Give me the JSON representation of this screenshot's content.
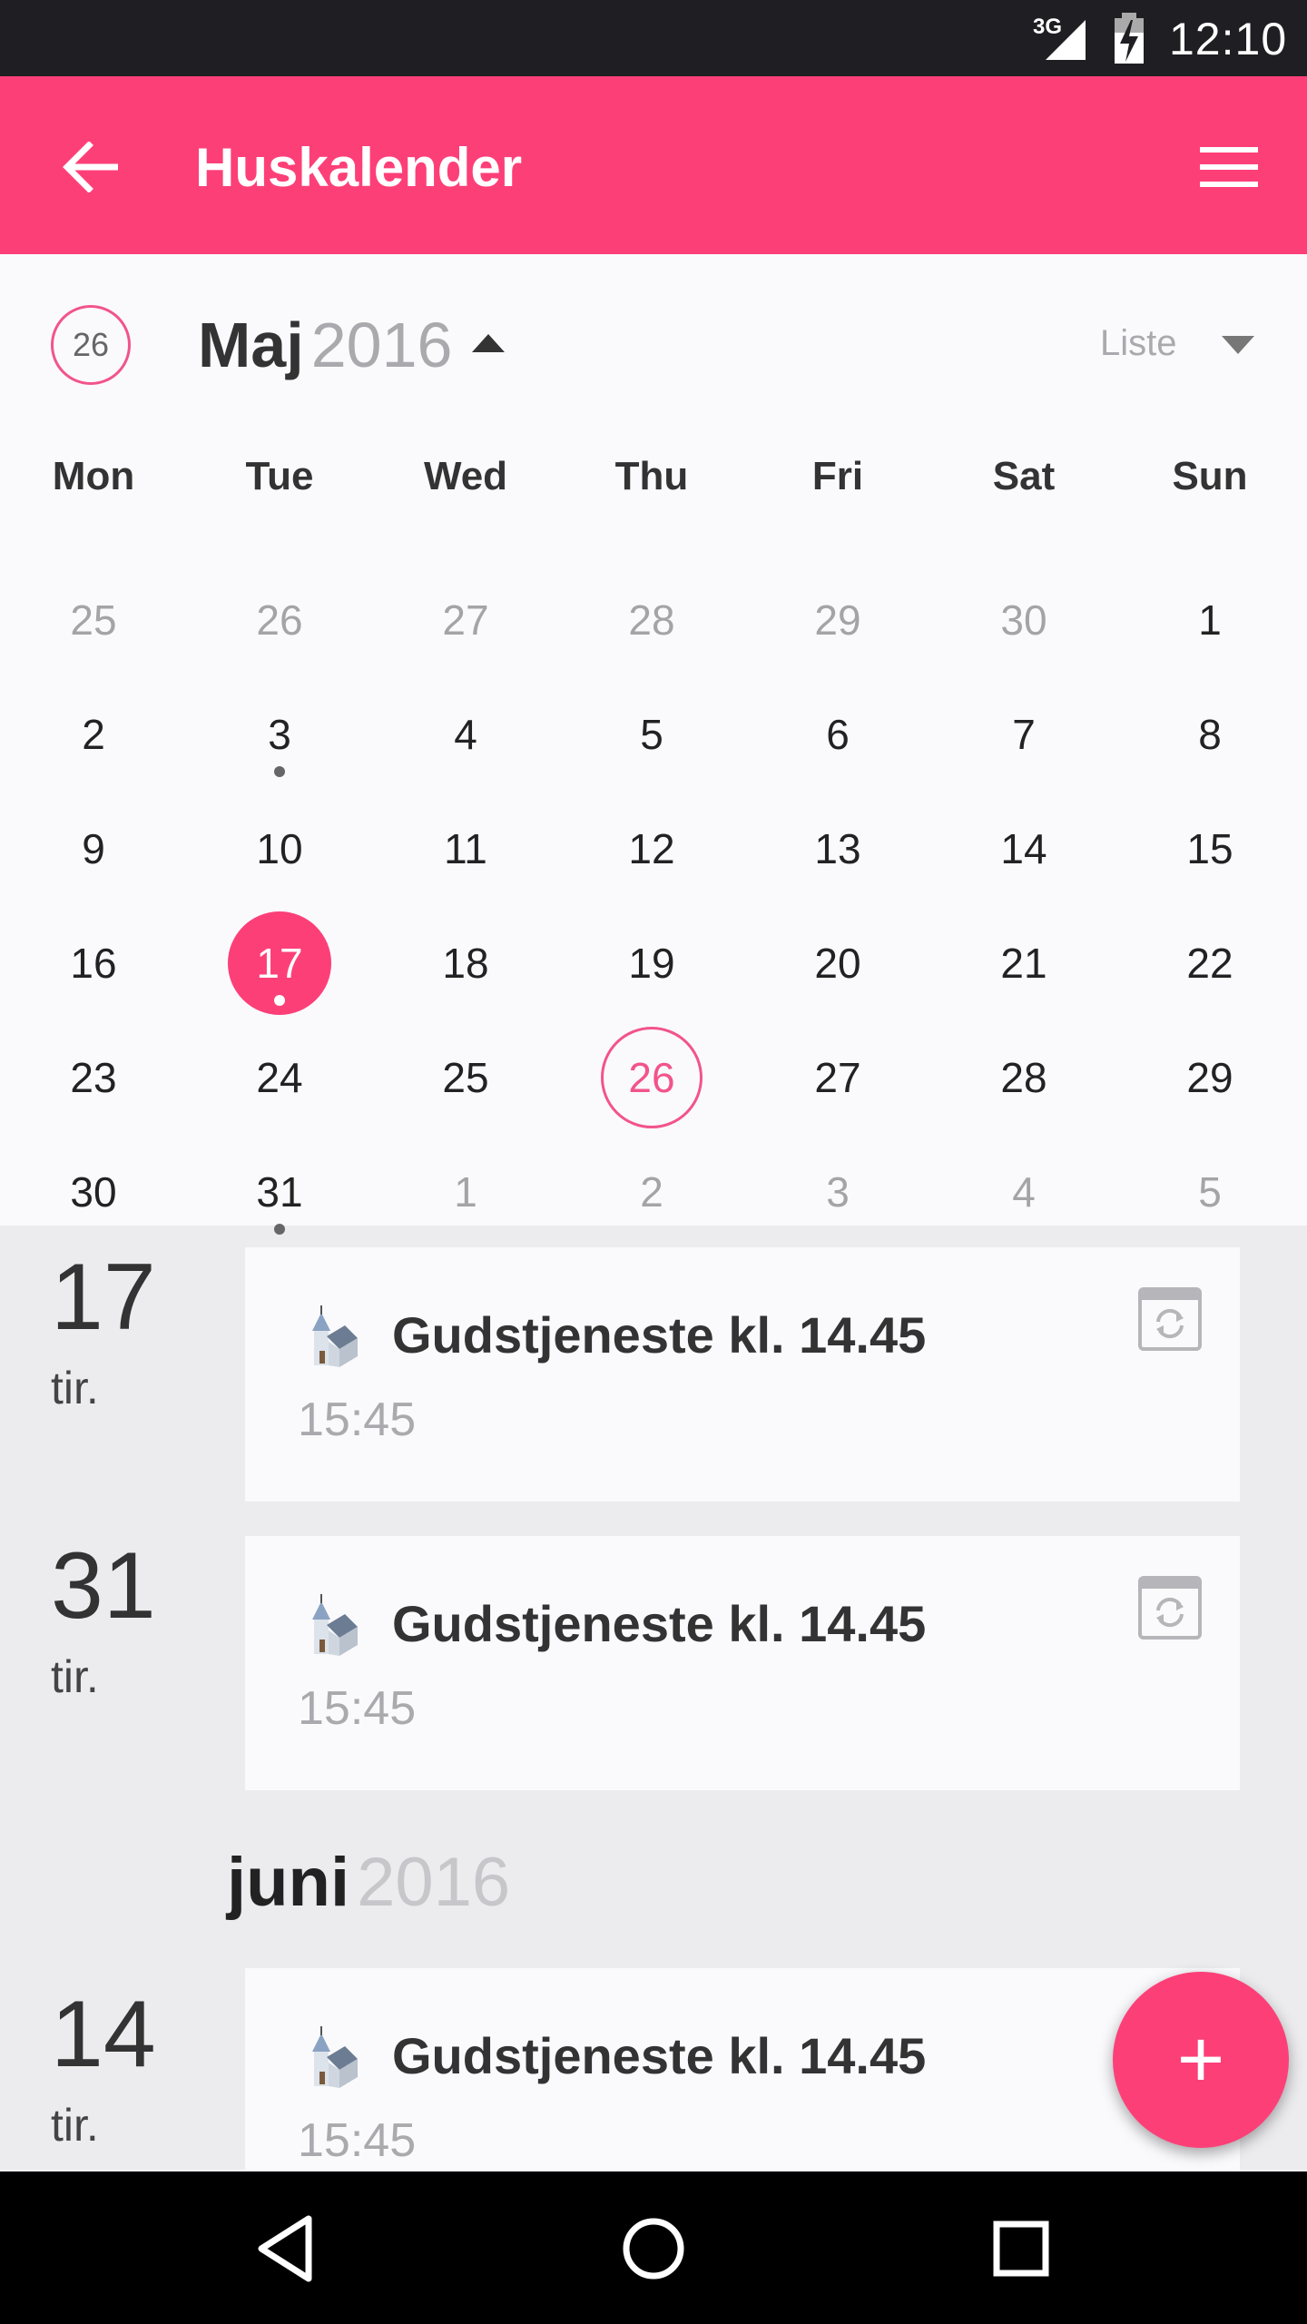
{
  "status_bar": {
    "network": "3G",
    "time": "12:10"
  },
  "app_bar": {
    "title": "Huskalender"
  },
  "calendar": {
    "today_badge": "26",
    "month": "Maj",
    "year": "2016",
    "view_selector": "Liste",
    "weekdays": [
      "Mon",
      "Tue",
      "Wed",
      "Thu",
      "Fri",
      "Sat",
      "Sun"
    ],
    "weeks": [
      [
        "25",
        "26",
        "27",
        "28",
        "29",
        "30",
        "1"
      ],
      [
        "2",
        "3",
        "4",
        "5",
        "6",
        "7",
        "8"
      ],
      [
        "9",
        "10",
        "11",
        "12",
        "13",
        "14",
        "15"
      ],
      [
        "16",
        "17",
        "18",
        "19",
        "20",
        "21",
        "22"
      ],
      [
        "23",
        "24",
        "25",
        "26",
        "27",
        "28",
        "29"
      ],
      [
        "30",
        "31",
        "1",
        "2",
        "3",
        "4",
        "5"
      ]
    ]
  },
  "events": [
    {
      "day": "17",
      "weekday": "tir.",
      "title": "Gudstjeneste kl. 14.45",
      "time": "15:45"
    },
    {
      "day": "31",
      "weekday": "tir.",
      "title": "Gudstjeneste kl. 14.45",
      "time": "15:45"
    },
    {
      "day": "14",
      "weekday": "tir.",
      "title": "Gudstjeneste kl. 14.45",
      "time": "15:45"
    }
  ],
  "next_month": {
    "month": "juni",
    "year": "2016"
  },
  "fab": {
    "label": "+"
  },
  "colors": {
    "accent": "#fd3f78",
    "status_bar": "#1f1f23",
    "nav_bar": "#000000"
  }
}
